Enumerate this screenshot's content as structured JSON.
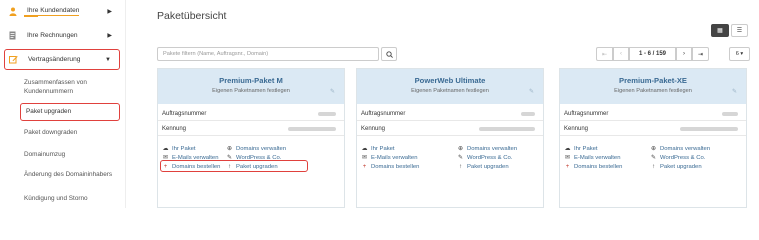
{
  "sidebar": {
    "items": [
      {
        "label": "Ihre Kundendaten",
        "icon": "user-icon"
      },
      {
        "label": "Ihre Rechnungen",
        "icon": "document-icon"
      },
      {
        "label": "Vertragsänderung",
        "icon": "edit-icon"
      }
    ],
    "sub_items": [
      {
        "label": "Zusammenfassen von Kundennummern"
      },
      {
        "label": "Paket upgraden"
      },
      {
        "label": "Paket downgraden"
      },
      {
        "label": "Domainumzug"
      },
      {
        "label": "Änderung des Domaininhabers"
      },
      {
        "label": "Kündigung und Storno"
      }
    ]
  },
  "main": {
    "title": "Paketübersicht",
    "filter_placeholder": "Pakete filtern (Name, Auftragsnr., Domain)",
    "pager": {
      "first": "⇤",
      "prev": "‹",
      "info": "1 - 6 / 159",
      "next": "›",
      "last": "⇥",
      "size": "6 ▾"
    },
    "view": {
      "grid": "▦",
      "list": "☰"
    }
  },
  "cards": [
    {
      "title": "Premium-Paket M",
      "subtitle": "Eigenen Paketnamen festlegen",
      "order_label": "Auftragsnummer",
      "id_label": "Kennung",
      "actions": {
        "left": [
          "Ihr Paket",
          "E-Mails verwalten",
          "Domains bestellen"
        ],
        "right": [
          "Domains verwalten",
          "WordPress & Co.",
          "Paket upgraden"
        ]
      }
    },
    {
      "title": "PowerWeb Ultimate",
      "subtitle": "Eigenen Paketnamen festlegen",
      "order_label": "Auftragsnummer",
      "id_label": "Kennung",
      "actions": {
        "left": [
          "Ihr Paket",
          "E-Mails verwalten",
          "Domains bestellen"
        ],
        "right": [
          "Domains verwalten",
          "WordPress & Co.",
          "Paket upgraden"
        ]
      }
    },
    {
      "title": "Premium-Paket-XE",
      "subtitle": "Eigenen Paketnamen festlegen",
      "order_label": "Auftragsnummer",
      "id_label": "Kennung",
      "actions": {
        "left": [
          "Ihr Paket",
          "E-Mails verwalten",
          "Domains bestellen"
        ],
        "right": [
          "Domains verwalten",
          "WordPress & Co.",
          "Paket upgraden"
        ]
      }
    }
  ],
  "icons": {
    "left": [
      "☁",
      "✉",
      "+"
    ],
    "right": [
      "⊕",
      "✎",
      "↑"
    ]
  },
  "colors": {
    "accent": "#3a6a93",
    "highlight": "#e0413d",
    "card_header": "#dbe9f4",
    "orange": "#f0a020"
  }
}
